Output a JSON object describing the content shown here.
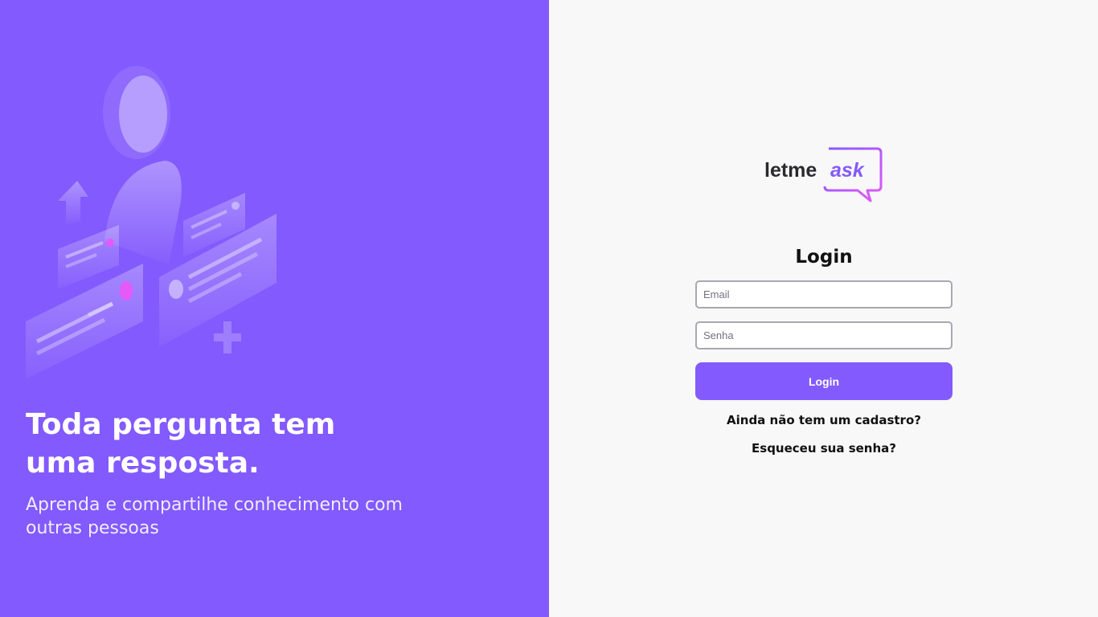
{
  "aside": {
    "headline_line1": "Toda pergunta tem",
    "headline_line2": "uma resposta.",
    "subline": "Aprenda e compartilhe conhecimento com outras pessoas",
    "illustration_icon": "questions-answers-illustration"
  },
  "logo": {
    "text_left": "letme",
    "text_right": "ask",
    "icon": "speech-bubble-icon"
  },
  "form": {
    "title": "Login",
    "email_placeholder": "Email",
    "email_value": "",
    "password_placeholder": "Senha",
    "password_value": "",
    "submit_label": "Login",
    "register_link": "Ainda não tem um cadastro?",
    "forgot_link": "Esqueceu sua senha?"
  },
  "colors": {
    "brand_purple": "#835afd",
    "accent_pink": "#e559f9",
    "background": "#f8f8f8",
    "text_dark": "#111111"
  }
}
